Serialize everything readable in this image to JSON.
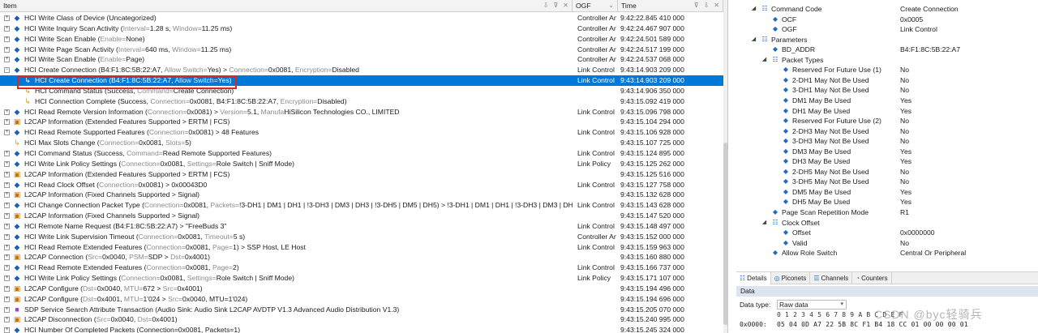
{
  "columns": {
    "item": "Item",
    "ogf": "OGF",
    "time": "Time"
  },
  "rows": [
    {
      "icon": "hci",
      "level": 0,
      "text": "HCI Write Class of Device (Uncategorized)",
      "ogf": "Controller And",
      "time": "9:42:22.845 410 000"
    },
    {
      "icon": "hci",
      "level": 0,
      "pre": "HCI Write Inquiry Scan Activity (",
      "dim": "Interval=",
      "mid": "1.28 s, ",
      "dim2": "Window=",
      "post": "11.25 ms)",
      "ogf": "Controller And",
      "time": "9:42:24.467 907 000"
    },
    {
      "icon": "hci",
      "level": 0,
      "pre": "HCI Write Scan Enable (",
      "dim": "Enable=",
      "mid": "None)",
      "ogf": "Controller And",
      "time": "9:42:24.501 589 000"
    },
    {
      "icon": "hci",
      "level": 0,
      "pre": "HCI Write Page Scan Activity (",
      "dim": "Interval=",
      "mid": "640 ms, ",
      "dim2": "Window=",
      "post": "11.25 ms)",
      "ogf": "Controller And",
      "time": "9:42:24.517 199 000"
    },
    {
      "icon": "hci",
      "level": 0,
      "pre": "HCI Write Scan Enable (",
      "dim": "Enable=",
      "mid": "Page)",
      "ogf": "Controller And",
      "time": "9:42:24.537 068 000"
    },
    {
      "icon": "hci",
      "level": 0,
      "expanded": true,
      "pre": "HCI Create Connection (B4:F1:8C:5B:22:A7, ",
      "dim": "Allow Switch=",
      "mid": "Yes) > ",
      "dim2": "Connection=",
      "post": "0x0081, ",
      "dim3": "Encryption=",
      "post2": "Disabled",
      "ogf": "Link Control",
      "time": "9:43:14.903 209 000"
    },
    {
      "icon": "arrow",
      "level": 1,
      "selected": true,
      "pre": "HCI Create Connection (B4:F1:8C:5B:22:A7, ",
      "dim": "Allow Switch=",
      "mid": "Yes)",
      "ogf": "Link Control",
      "time": "9:43:14.903 209 000"
    },
    {
      "icon": "arrow",
      "level": 1,
      "pre": "HCI Command Status (Success, ",
      "dim": "Command=",
      "mid": "Create Connection)",
      "ogf": "",
      "time": "9:43:14.906 350 000"
    },
    {
      "icon": "arrow",
      "level": 1,
      "pre": "HCI Connection Complete (Success, ",
      "dim": "Connection=",
      "mid": "0x0081, B4:F1:8C:5B:22:A7, ",
      "dim2": "Encryption=",
      "post": "Disabled)",
      "ogf": "",
      "time": "9:43:15.092 419 000"
    },
    {
      "icon": "hci",
      "level": 0,
      "pre": "HCI Read Remote Version Information (",
      "dim": "Connection=",
      "mid": "0x0081) > ",
      "dim2": "Version=",
      "post": "5.1, ",
      "dim3": "Manufa",
      "post2": "HiSilicon Technologies CO., LIMITED",
      "ogf": "Link Control",
      "time": "9:43:15.096 798 000"
    },
    {
      "icon": "l2",
      "level": 0,
      "text": "L2CAP Information (Extended Features Supported > ERTM | FCS)",
      "ogf": "",
      "time": "9:43:15.104 294 000"
    },
    {
      "icon": "hci",
      "level": 0,
      "pre": "HCI Read Remote Supported Features (",
      "dim": "Connection=",
      "mid": "0x0081) > 48 Features",
      "ogf": "Link Control",
      "time": "9:43:15.106 928 000"
    },
    {
      "icon": "arrow",
      "level": 0,
      "noexp": true,
      "pre": "HCI Max Slots Change (",
      "dim": "Connection=",
      "mid": "0x0081, ",
      "dim2": "Slots=",
      "post": "5)",
      "ogf": "",
      "time": "9:43:15.107 725 000"
    },
    {
      "icon": "hci",
      "level": 0,
      "pre": "HCI Command Status (Success, ",
      "dim": "Command=",
      "mid": "Read Remote Supported Features)",
      "ogf": "Link Control",
      "time": "9:43:15.124 895 000"
    },
    {
      "icon": "hci",
      "level": 0,
      "pre": "HCI Write Link Policy Settings (",
      "dim": "Connection=",
      "mid": "0x0081, ",
      "dim2": "Settings=",
      "post": "Role Switch | Sniff Mode)",
      "ogf": "Link Policy",
      "time": "9:43:15.125 262 000"
    },
    {
      "icon": "l2",
      "level": 0,
      "text": "L2CAP Information (Extended Features Supported > ERTM | FCS)",
      "ogf": "",
      "time": "9:43:15.125 516 000"
    },
    {
      "icon": "hci",
      "level": 0,
      "pre": "HCI Read Clock Offset (",
      "dim": "Connection=",
      "mid": "0x0081) > 0x00043D0",
      "ogf": "Link Control",
      "time": "9:43:15.127 758 000"
    },
    {
      "icon": "l2",
      "level": 0,
      "text": "L2CAP Information (Fixed Channels Supported > Signal)",
      "ogf": "",
      "time": "9:43:15.132 628 000"
    },
    {
      "icon": "hci",
      "level": 0,
      "pre": "HCI Change Connection Packet Type (",
      "dim": "Connection=",
      "mid": "0x0081, ",
      "dim2": "Packets=",
      "post": "!3-DH1 | DM1 | DH1 | !3-DH3 | DM3 | DH3 | !3-DH5 | DM5 | DH5) > !3-DH1 | DM1 | DH1 | !3-DH3 | DM3 | DH3 | !3-DH5 | DM5 | ...",
      "ogf": "Link Control",
      "time": "9:43:15.143 628 000"
    },
    {
      "icon": "l2",
      "level": 0,
      "text": "L2CAP Information (Fixed Channels Supported > Signal)",
      "ogf": "",
      "time": "9:43:15.147 520 000"
    },
    {
      "icon": "hci",
      "level": 0,
      "text": "HCI Remote Name Request (B4:F1:8C:5B:22:A7) > \"FreeBuds 3\"",
      "ogf": "Link Control",
      "time": "9:43:15.148 497 000"
    },
    {
      "icon": "hci",
      "level": 0,
      "pre": "HCI Write Link Supervision Timeout (",
      "dim": "Connection=",
      "mid": "0x0081, ",
      "dim2": "Timeout=",
      "post": "5 s)",
      "ogf": "Controller And",
      "time": "9:43:15.152 000 000"
    },
    {
      "icon": "hci",
      "level": 0,
      "pre": "HCI Read Remote Extended Features (",
      "dim": "Connection=",
      "mid": "0x0081, ",
      "dim2": "Page=",
      "post": "1) > SSP Host, LE Host",
      "ogf": "Link Control",
      "time": "9:43:15.159 963 000"
    },
    {
      "icon": "l2",
      "level": 0,
      "pre": "L2CAP Connection (",
      "dim": "Src=",
      "mid": "0x0040, ",
      "dim2": "PSM=",
      "post": "SDP > ",
      "dim3": "Dst=",
      "post2": "0x4001)",
      "ogf": "",
      "time": "9:43:15.160 880 000"
    },
    {
      "icon": "hci",
      "level": 0,
      "pre": "HCI Read Remote Extended Features (",
      "dim": "Connection=",
      "mid": "0x0081, ",
      "dim2": "Page=",
      "post": "2)",
      "ogf": "Link Control",
      "time": "9:43:15.166 737 000"
    },
    {
      "icon": "hci",
      "level": 0,
      "pre": "HCI Write Link Policy Settings (",
      "dim": "Connection=",
      "mid": "0x0081, ",
      "dim2": "Settings=",
      "post": "Role Switch | Sniff Mode)",
      "ogf": "Link Policy",
      "time": "9:43:15.171 107 000"
    },
    {
      "icon": "l2",
      "level": 0,
      "pre": "L2CAP Configure (",
      "dim": "Dst=",
      "mid": "0x0040, ",
      "dim2": "MTU=",
      "post": "672 > ",
      "dim3": "Src=",
      "post2": "0x4001)",
      "ogf": "",
      "time": "9:43:15.194 496 000"
    },
    {
      "icon": "l2",
      "level": 0,
      "pre": "L2CAP Configure (",
      "dim": "Dst=",
      "mid": "0x4001, ",
      "dim2": "MTU=",
      "post": "1'024 > ",
      "dim3": "Src=",
      "post2": "0x0040, MTU=1'024)",
      "ogf": "",
      "time": "9:43:15.194 696 000"
    },
    {
      "icon": "sdp",
      "level": 0,
      "text": "SDP Service Search Attribute Transaction (Audio Sink: Audio Sink L2CAP AVDTP V1.3 Advanced Audio Distribution V1.3)",
      "ogf": "",
      "time": "9:43:15.205 070 000"
    },
    {
      "icon": "l2",
      "level": 0,
      "pre": "L2CAP Disconnection (",
      "dim": "Src=",
      "mid": "0x0040, ",
      "dim2": "Dst=",
      "post": "0x4001)",
      "ogf": "",
      "time": "9:43:15.240 995 000"
    },
    {
      "icon": "hci",
      "level": 0,
      "text": "HCI Number Of Completed Packets (Connection=0x0081, Packets=1)",
      "ogf": "",
      "time": "9:43:15.245 324 000"
    }
  ],
  "details": [
    {
      "level": 0,
      "exp": "-",
      "icon": "param",
      "label": "Command Code",
      "value": "Create Connection"
    },
    {
      "level": 1,
      "icon": "bullet",
      "label": "OCF",
      "value": "0x0005"
    },
    {
      "level": 1,
      "icon": "bullet",
      "label": "OGF",
      "value": "Link Control"
    },
    {
      "level": 0,
      "exp": "-",
      "icon": "param",
      "label": "Parameters",
      "value": ""
    },
    {
      "level": 1,
      "icon": "bullet",
      "label": "BD_ADDR",
      "value": "B4:F1:8C:5B:22:A7"
    },
    {
      "level": 1,
      "exp": "-",
      "icon": "param",
      "label": "Packet Types",
      "value": ""
    },
    {
      "level": 2,
      "icon": "bullet",
      "label": "Reserved For Future Use (1)",
      "value": "No"
    },
    {
      "level": 2,
      "icon": "bullet",
      "label": "2-DH1 May Not Be Used",
      "value": "No"
    },
    {
      "level": 2,
      "icon": "bullet",
      "label": "3-DH1 May Not Be Used",
      "value": "No"
    },
    {
      "level": 2,
      "icon": "bullet",
      "label": "DM1 May Be Used",
      "value": "Yes"
    },
    {
      "level": 2,
      "icon": "bullet",
      "label": "DH1 May Be Used",
      "value": "Yes"
    },
    {
      "level": 2,
      "icon": "bullet",
      "label": "Reserved For Future Use (2)",
      "value": "No"
    },
    {
      "level": 2,
      "icon": "bullet",
      "label": "2-DH3 May Not Be Used",
      "value": "No"
    },
    {
      "level": 2,
      "icon": "bullet",
      "label": "3-DH3 May Not Be Used",
      "value": "No"
    },
    {
      "level": 2,
      "icon": "bullet",
      "label": "DM3 May Be Used",
      "value": "Yes"
    },
    {
      "level": 2,
      "icon": "bullet",
      "label": "DH3 May Be Used",
      "value": "Yes"
    },
    {
      "level": 2,
      "icon": "bullet",
      "label": "2-DH5 May Not Be Used",
      "value": "No"
    },
    {
      "level": 2,
      "icon": "bullet",
      "label": "3-DH5 May Not Be Used",
      "value": "No"
    },
    {
      "level": 2,
      "icon": "bullet",
      "label": "DM5 May Be Used",
      "value": "Yes"
    },
    {
      "level": 2,
      "icon": "bullet",
      "label": "DH5 May Be Used",
      "value": "Yes"
    },
    {
      "level": 1,
      "icon": "bullet",
      "label": "Page Scan Repetition Mode",
      "value": "R1"
    },
    {
      "level": 1,
      "exp": "-",
      "icon": "param",
      "label": "Clock Offset",
      "value": ""
    },
    {
      "level": 2,
      "icon": "bullet",
      "label": "Offset",
      "value": "0x0000000"
    },
    {
      "level": 2,
      "icon": "bullet",
      "label": "Valid",
      "value": "No"
    },
    {
      "level": 1,
      "icon": "bullet",
      "label": "Allow Role Switch",
      "value": "Central Or Peripheral"
    }
  ],
  "tabs": [
    {
      "label": "Details",
      "active": true
    },
    {
      "label": "Piconets",
      "active": false
    },
    {
      "label": "Channels",
      "active": false
    },
    {
      "label": "Counters",
      "active": false
    }
  ],
  "data_panel": {
    "title": "Data",
    "type_label": "Data type:",
    "type_value": "Raw data",
    "hex_header": "0  1  2  3  4  5  6  7  8  9  A  B  C  D  E  F",
    "hex_address": "0x0000:",
    "hex_bytes": "05 04 0D A7 22 5B 8C F1 B4 18 CC 01 00 00 00 01"
  },
  "watermark": "CSDN @byc轻骑兵"
}
